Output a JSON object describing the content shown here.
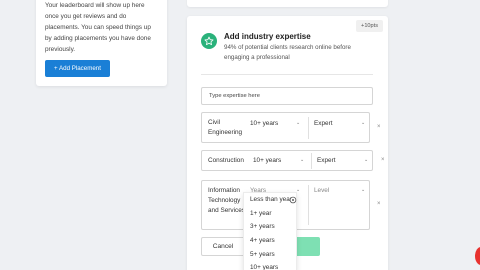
{
  "left_card": {
    "text": "Your leaderboard will show up here once you get reviews and do placements. You can speed things up by adding placements you have done previously.",
    "add_button": "+ Add Placement"
  },
  "main_card": {
    "points_badge": "+10pts",
    "title": "Add industry expertise",
    "description": "94% of potential clients research online before engaging a professional",
    "search_placeholder": "Type expertise here",
    "rows": [
      {
        "name": "Civil Engineering",
        "years": "10+ years",
        "level": "Expert"
      },
      {
        "name": "Construction",
        "years": "10+ years",
        "level": "Expert"
      },
      {
        "name": "Information Technology and Services",
        "years": "Years",
        "level": "Level"
      }
    ],
    "remove_symbol": "×",
    "cancel_label": "Cancel"
  },
  "dropdown": {
    "options": [
      "Less than year",
      "1+ year",
      "3+ years",
      "4+ years",
      "5+ years",
      "10+ years"
    ]
  },
  "colors": {
    "primary_blue": "#1a7fd6",
    "green": "#2ab27b",
    "green_light": "#7ee0b3"
  }
}
